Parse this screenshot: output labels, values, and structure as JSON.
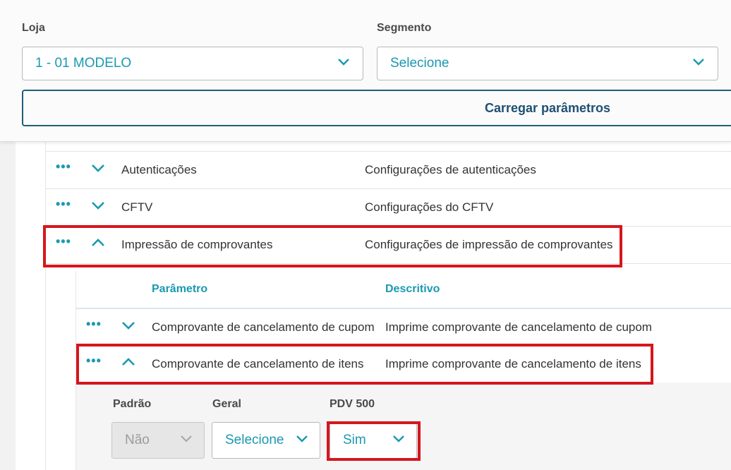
{
  "filters": {
    "loja": {
      "label": "Loja",
      "value": "1 - 01 MODELO"
    },
    "segmento": {
      "label": "Segmento",
      "value": "Selecione"
    },
    "load_button": "Carregar parâmetros"
  },
  "groups": [
    {
      "name": "Autenticações",
      "description": "Configurações de autenticações",
      "expanded": false
    },
    {
      "name": "CFTV",
      "description": "Configurações do CFTV",
      "expanded": false
    },
    {
      "name": "Impressão de comprovantes",
      "description": "Configurações de impressão de comprovantes",
      "expanded": true
    }
  ],
  "params_table": {
    "headers": {
      "parametro": "Parâmetro",
      "descritivo": "Descritivo"
    },
    "rows": [
      {
        "name": "Comprovante de cancelamento de cupom",
        "description": "Imprime comprovante de cancelamento de cupom",
        "expanded": false
      },
      {
        "name": "Comprovante de cancelamento de itens",
        "description": "Imprime comprovante de cancelamento de itens",
        "expanded": true
      }
    ]
  },
  "detail": {
    "padrao": {
      "label": "Padrão",
      "value": "Não",
      "disabled": true
    },
    "geral": {
      "label": "Geral",
      "value": "Selecione"
    },
    "pdv500": {
      "label": "PDV 500",
      "value": "Sim"
    }
  },
  "colors": {
    "accent": "#1a99b1",
    "highlight": "#d6161d",
    "button_border": "#1f5e7a"
  },
  "icons": {
    "more": "more-dots-icon",
    "collapsed": "chevron-down-icon",
    "expanded": "chevron-up-icon"
  }
}
